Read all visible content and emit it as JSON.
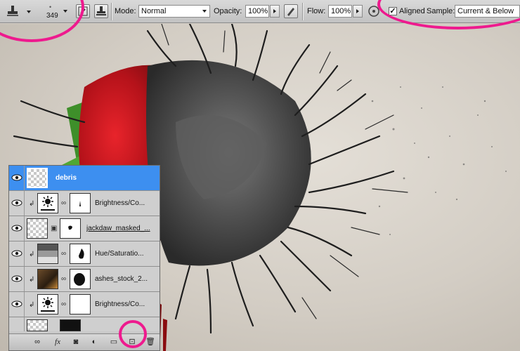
{
  "options_bar": {
    "brush_size": "349",
    "mode_label": "Mode:",
    "mode_value": "Normal",
    "opacity_label": "Opacity:",
    "opacity_value": "100%",
    "flow_label": "Flow:",
    "flow_value": "100%",
    "aligned_label": "Aligned",
    "aligned_checked": "✓",
    "sample_label": "Sample:",
    "sample_value": "Current & Below"
  },
  "layers": [
    {
      "name": "debris",
      "selected": true,
      "thumb_icon": "checker-thumb"
    },
    {
      "name": "Brightness/Co...",
      "thumb_icon": "brightness-adjustment-icon",
      "clipped": true
    },
    {
      "name": "jackdaw_masked_...",
      "thumb_icon": "checker-thumb"
    },
    {
      "name": "Hue/Saturatio...",
      "thumb_icon": "hue-saturation-icon",
      "clipped": true
    },
    {
      "name": "ashes_stock_2...",
      "thumb_icon": "photo-thumb",
      "clipped": true
    },
    {
      "name": "Brightness/Co...",
      "thumb_icon": "brightness-adjustment-icon",
      "clipped": true
    }
  ],
  "panel_icons": [
    "link-icon",
    "fx-icon",
    "add-mask-icon",
    "adjustment-icon",
    "folder-icon",
    "new-layer-icon",
    "trash-icon"
  ],
  "panel_fx_label": "fx",
  "colors": {
    "highlight": "#ee1a8e",
    "selected_layer": "#3d8ff0",
    "rose_red": "#c8141a"
  }
}
